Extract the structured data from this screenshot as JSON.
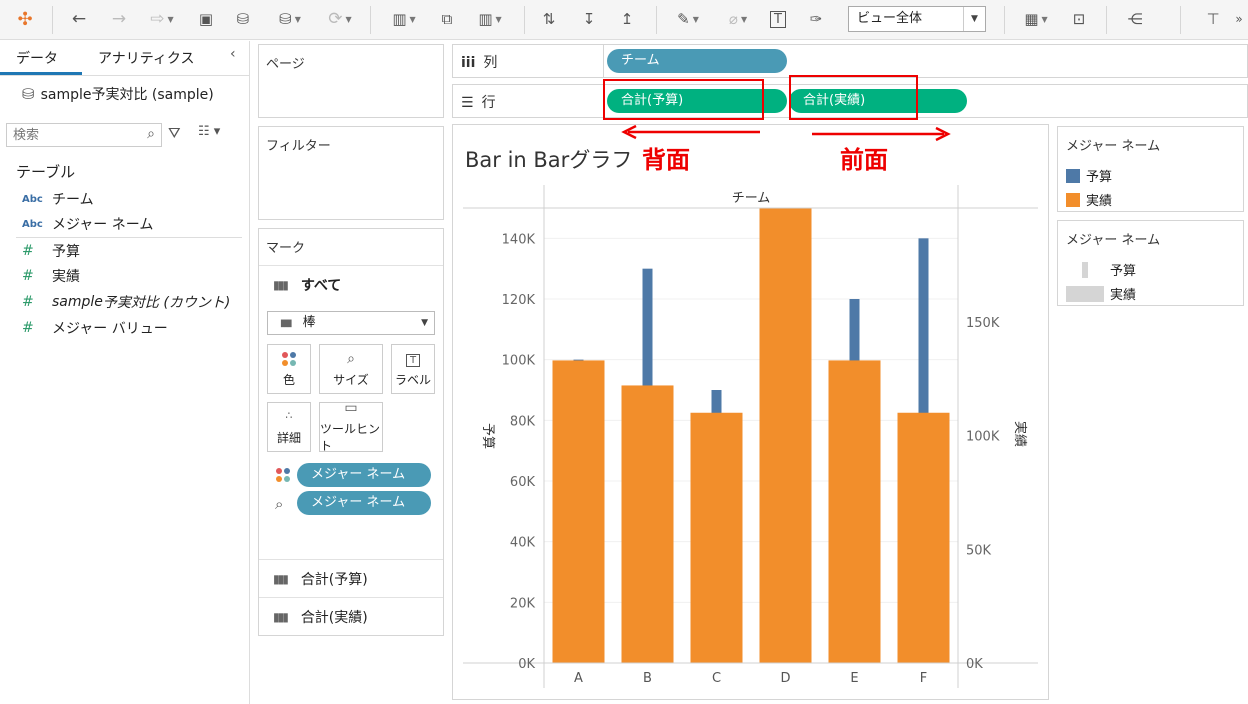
{
  "toolbar": {
    "view_size": "ビュー全体"
  },
  "data_pane": {
    "tabs": [
      "データ",
      "アナリティクス"
    ],
    "collapse": "‹",
    "datasource": "sample予実対比 (sample)",
    "search_placeholder": "検索",
    "tables_heading": "テーブル",
    "fields": [
      {
        "type": "Abc",
        "name": "チーム"
      },
      {
        "type": "Abc",
        "name": "メジャー ネーム"
      },
      {
        "type": "#",
        "name": "予算"
      },
      {
        "type": "#",
        "name": "実績"
      },
      {
        "type": "#",
        "name_italic": "sample",
        "name_rest": "予実対比 (カウント)"
      },
      {
        "type": "#",
        "name": "メジャー バリュー"
      }
    ]
  },
  "pages": {
    "label": "ページ"
  },
  "filters": {
    "label": "フィルター"
  },
  "marks": {
    "label": "マーク",
    "all_label": "すべて",
    "mark_type": "棒",
    "buttons": {
      "color": "色",
      "size": "サイズ",
      "label": "ラベル",
      "detail": "詳細",
      "tooltip": "ツールヒント"
    },
    "pills": [
      "メジャー ネーム",
      "メジャー ネーム"
    ],
    "measures": [
      "合計(予算)",
      "合計(実績)"
    ]
  },
  "columns_shelf": {
    "label": "列",
    "pills": [
      "チーム"
    ]
  },
  "rows_shelf": {
    "label": "行",
    "pills": [
      "合計(予算)",
      "合計(実績)"
    ]
  },
  "annotations": {
    "back": "背面",
    "front": "前面"
  },
  "legends": [
    {
      "title": "メジャー ネーム",
      "items": [
        {
          "name": "予算",
          "color": "#4e79a7"
        },
        {
          "name": "実績",
          "color": "#f28e2b"
        }
      ]
    },
    {
      "title": "メジャー ネーム",
      "items": [
        {
          "name": "予算"
        },
        {
          "name": "実績"
        }
      ]
    }
  ],
  "chart_data": {
    "type": "bar",
    "title": "Bar in Barグラフ",
    "header": "チーム",
    "categories": [
      "A",
      "B",
      "C",
      "D",
      "E",
      "F"
    ],
    "series": [
      {
        "name": "予算",
        "color": "#4e79a7",
        "values": [
          100000,
          130000,
          90000,
          150000,
          120000,
          140000
        ],
        "axis": "left"
      },
      {
        "name": "実績",
        "color": "#f28e2b",
        "values": [
          133000,
          122000,
          110000,
          200000,
          133000,
          110000
        ],
        "axis": "right"
      }
    ],
    "left_axis": {
      "label": "予算",
      "range": [
        0,
        150000
      ],
      "ticks": [
        "0K",
        "20K",
        "40K",
        "60K",
        "80K",
        "100K",
        "120K",
        "140K"
      ]
    },
    "right_axis": {
      "label": "実績",
      "range": [
        0,
        200000
      ],
      "ticks": [
        "0K",
        "50K",
        "100K",
        "150K"
      ]
    }
  }
}
